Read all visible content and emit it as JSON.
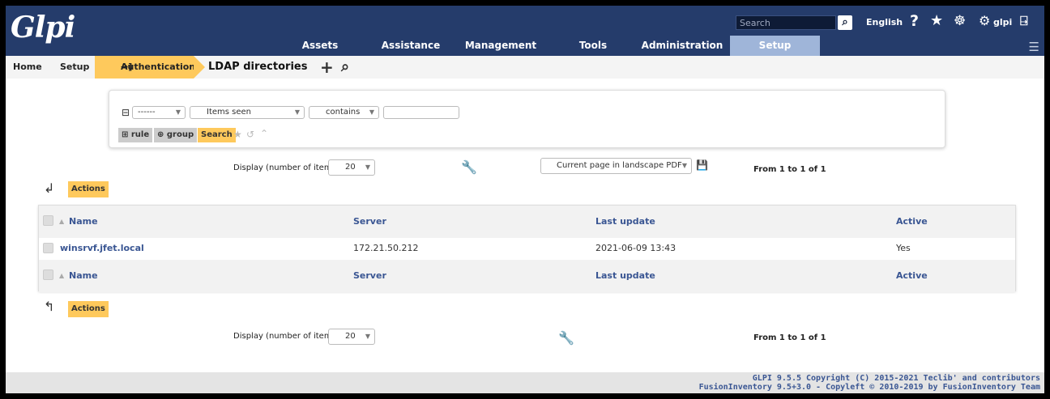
{
  "header": {
    "logo": "Glpi",
    "search_placeholder": "Search",
    "language": "English",
    "user": "glpi"
  },
  "menu": {
    "items": [
      "Assets",
      "Assistance",
      "Management",
      "Tools",
      "Administration",
      "Setup"
    ],
    "active": "Setup"
  },
  "breadcrumb": {
    "home": "Home",
    "setup": "Setup",
    "authentication": "Authentication",
    "title": "LDAP directories"
  },
  "search": {
    "link_value": "------",
    "field": "Items seen",
    "operator": "contains",
    "value": "",
    "rule_label": "rule",
    "group_label": "group",
    "search_label": "Search"
  },
  "pager": {
    "display_label": "Display (number of items)",
    "display_value": "20",
    "export_option": "Current page in landscape PDF",
    "count": "From 1 to 1 of 1"
  },
  "actions_label": "Actions",
  "table": {
    "columns": [
      "Name",
      "Server",
      "Last update",
      "Active"
    ],
    "rows": [
      [
        "winsrvf.jfet.local",
        "172.21.50.212",
        "2021-06-09 13:43",
        "Yes"
      ]
    ]
  },
  "footer": {
    "line1": "GLPI 9.5.5 Copyright (C) 2015-2021 Teclib' and contributors",
    "line2": "FusionInventory 9.5+3.0 - Copyleft © 2010-2019 by FusionInventory Team"
  }
}
